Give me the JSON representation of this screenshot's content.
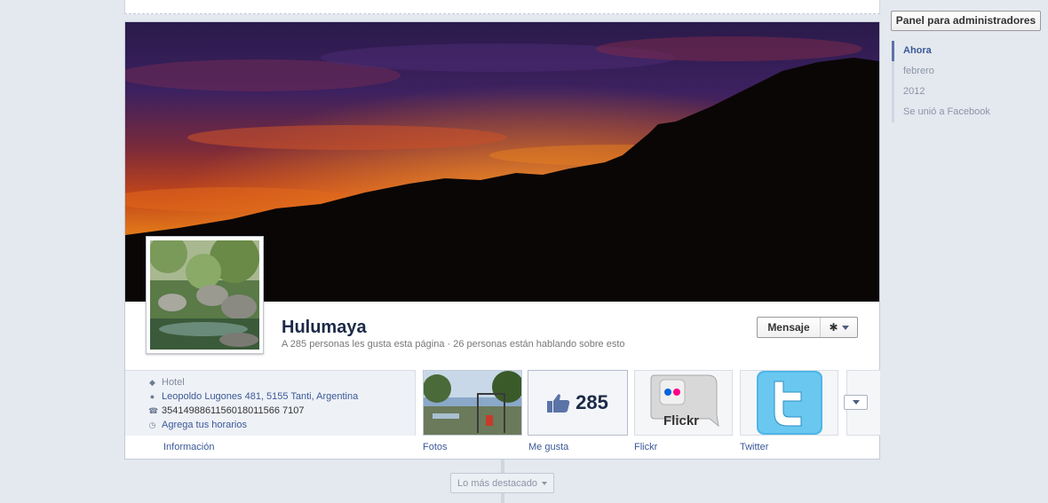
{
  "page": {
    "name": "Hulumaya",
    "stats": "A 285 personas les gusta esta página · 26 personas están hablando sobre esto"
  },
  "actions": {
    "message_label": "Mensaje",
    "admin_panel_label": "Panel para administradores",
    "highlights_label": "Lo más destacado"
  },
  "about": {
    "category": "Hotel",
    "address": "Leopoldo Lugones 481, 5155 Tanti, Argentina",
    "phone": "3541498861156018011566 7107",
    "hours_link": "Agrega tus horarios"
  },
  "tabs": [
    {
      "label": "Información"
    },
    {
      "label": "Fotos"
    },
    {
      "label": "Me gusta",
      "count": "285"
    },
    {
      "label": "Flickr",
      "logo_text": "Flickr"
    },
    {
      "label": "Twitter"
    }
  ],
  "timeline_nav": [
    {
      "label": "Ahora",
      "active": true
    },
    {
      "label": "febrero",
      "active": false
    },
    {
      "label": "2012",
      "active": false
    },
    {
      "label": "Se unió a Facebook",
      "active": false
    }
  ],
  "colors": {
    "link": "#3b5998",
    "name": "#1c2a47",
    "page_bg": "#e4e8ef"
  }
}
